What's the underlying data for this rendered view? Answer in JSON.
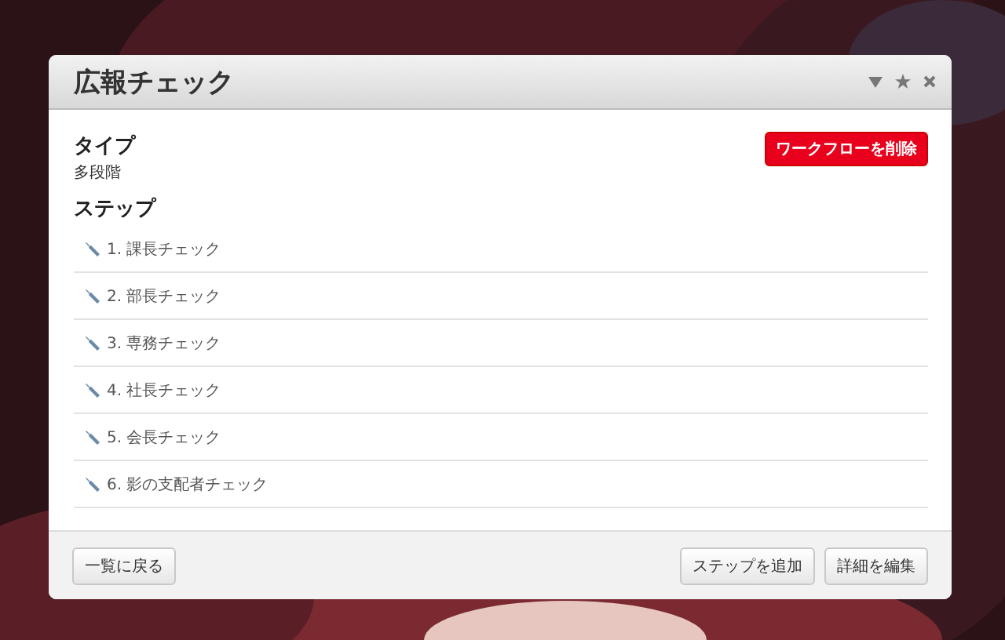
{
  "window": {
    "title": "広報チェック"
  },
  "type": {
    "heading": "タイプ",
    "value": "多段階"
  },
  "delete_button": "ワークフローを削除",
  "steps": {
    "heading": "ステップ",
    "items": [
      {
        "label": "1. 課長チェック"
      },
      {
        "label": "2. 部長チェック"
      },
      {
        "label": "3. 専務チェック"
      },
      {
        "label": "4. 社長チェック"
      },
      {
        "label": "5. 会長チェック"
      },
      {
        "label": "6. 影の支配者チェック"
      }
    ]
  },
  "footer": {
    "back_button": "一覧に戻る",
    "buttons": [
      "ステップを追加",
      "詳細を編集"
    ]
  }
}
